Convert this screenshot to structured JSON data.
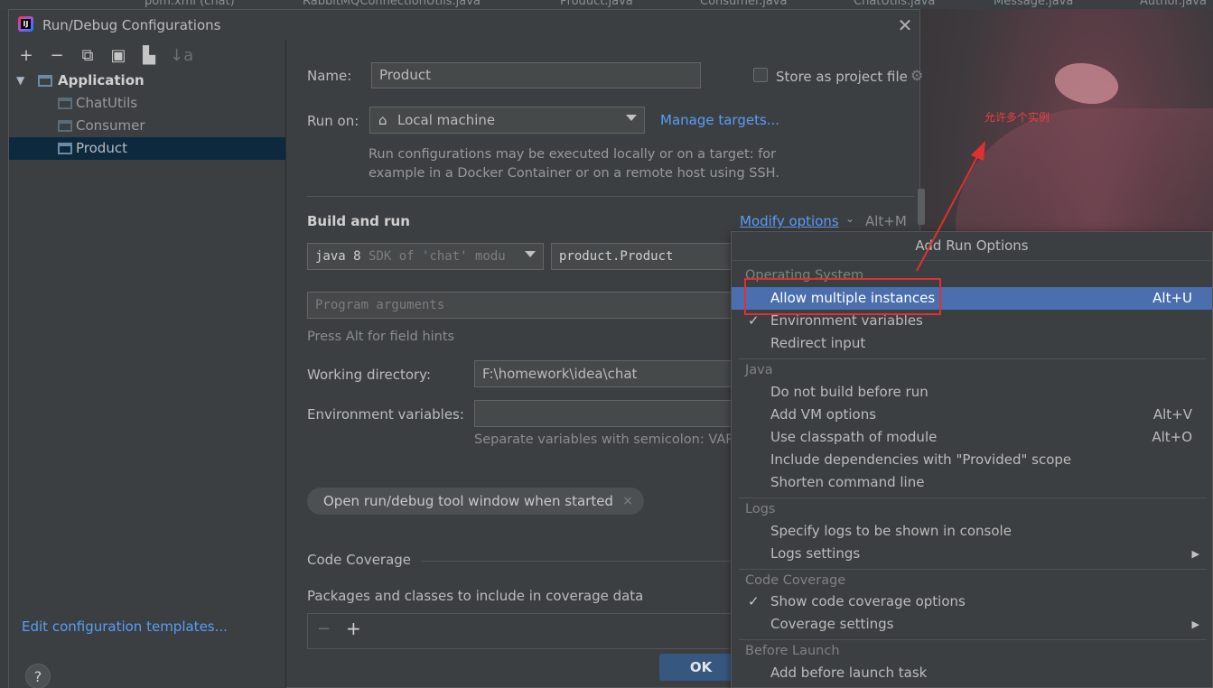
{
  "background_tabs": [
    "pom.xml (chat)",
    "RabbitMQConnectionUtils.java",
    "Product.java",
    "Consumer.java",
    "ChatUtils.java",
    "Message.java",
    "Author.java"
  ],
  "dialog": {
    "title": "Run/Debug Configurations",
    "close_icon": "close-icon"
  },
  "toolbar": {
    "add": "+",
    "remove": "−",
    "copy": "⧉",
    "save": "▣",
    "folder": "▙",
    "sort": "↓a"
  },
  "tree": {
    "root_label": "Application",
    "children": [
      "ChatUtils",
      "Consumer",
      "Product"
    ]
  },
  "left_footer": {
    "edit_templates": "Edit configuration templates...",
    "help": "?"
  },
  "form": {
    "name_label": "Name:",
    "name_value": "Product",
    "store_label": "Store as project file",
    "run_on_label": "Run on:",
    "run_on_value": "Local machine",
    "manage_targets": "Manage targets...",
    "run_on_hint_1": "Run configurations may be executed locally or on a target: for",
    "run_on_hint_2": "example in a Docker Container or on a remote host using SSH.",
    "build_run_title": "Build and run",
    "modify_options": "Modify options",
    "modify_shortcut": "Alt+M",
    "jre_value": "java 8",
    "jre_hint": "SDK of 'chat' modu",
    "main_class": "product.Product",
    "program_args_placeholder": "Program arguments",
    "field_hints": "Press Alt for field hints",
    "working_dir_label": "Working directory:",
    "working_dir_value": "F:\\homework\\idea\\chat",
    "env_vars_label": "Environment variables:",
    "env_vars_value": "",
    "env_hint": "Separate variables with semicolon: VAR",
    "chip_label": "Open run/debug tool window when started",
    "chip_close": "×",
    "code_coverage_title": "Code Coverage",
    "packages_label": "Packages and classes to include in coverage data",
    "cov_remove": "−",
    "cov_add": "+",
    "ok": "OK"
  },
  "popup": {
    "title": "Add Run Options",
    "groups": {
      "os": "Operating System",
      "java": "Java",
      "logs": "Logs",
      "coverage": "Code Coverage",
      "before": "Before Launch"
    },
    "items": {
      "allow_multiple": "Allow multiple instances",
      "allow_multiple_sc": "Alt+U",
      "env_vars": "Environment variables",
      "redirect_input": "Redirect input",
      "no_build": "Do not build before run",
      "vm_options": "Add VM options",
      "vm_options_sc": "Alt+V",
      "classpath": "Use classpath of module",
      "classpath_sc": "Alt+O",
      "provided": "Include dependencies with \"Provided\" scope",
      "shorten": "Shorten command line",
      "logs_console": "Specify logs to be shown in console",
      "logs_settings": "Logs settings",
      "show_coverage": "Show code coverage options",
      "coverage_settings": "Coverage settings",
      "before_task": "Add before launch task"
    },
    "check": "✓",
    "submenu": "▶"
  },
  "annotation": {
    "text": "允许多个实例",
    "color": "#e03030"
  }
}
